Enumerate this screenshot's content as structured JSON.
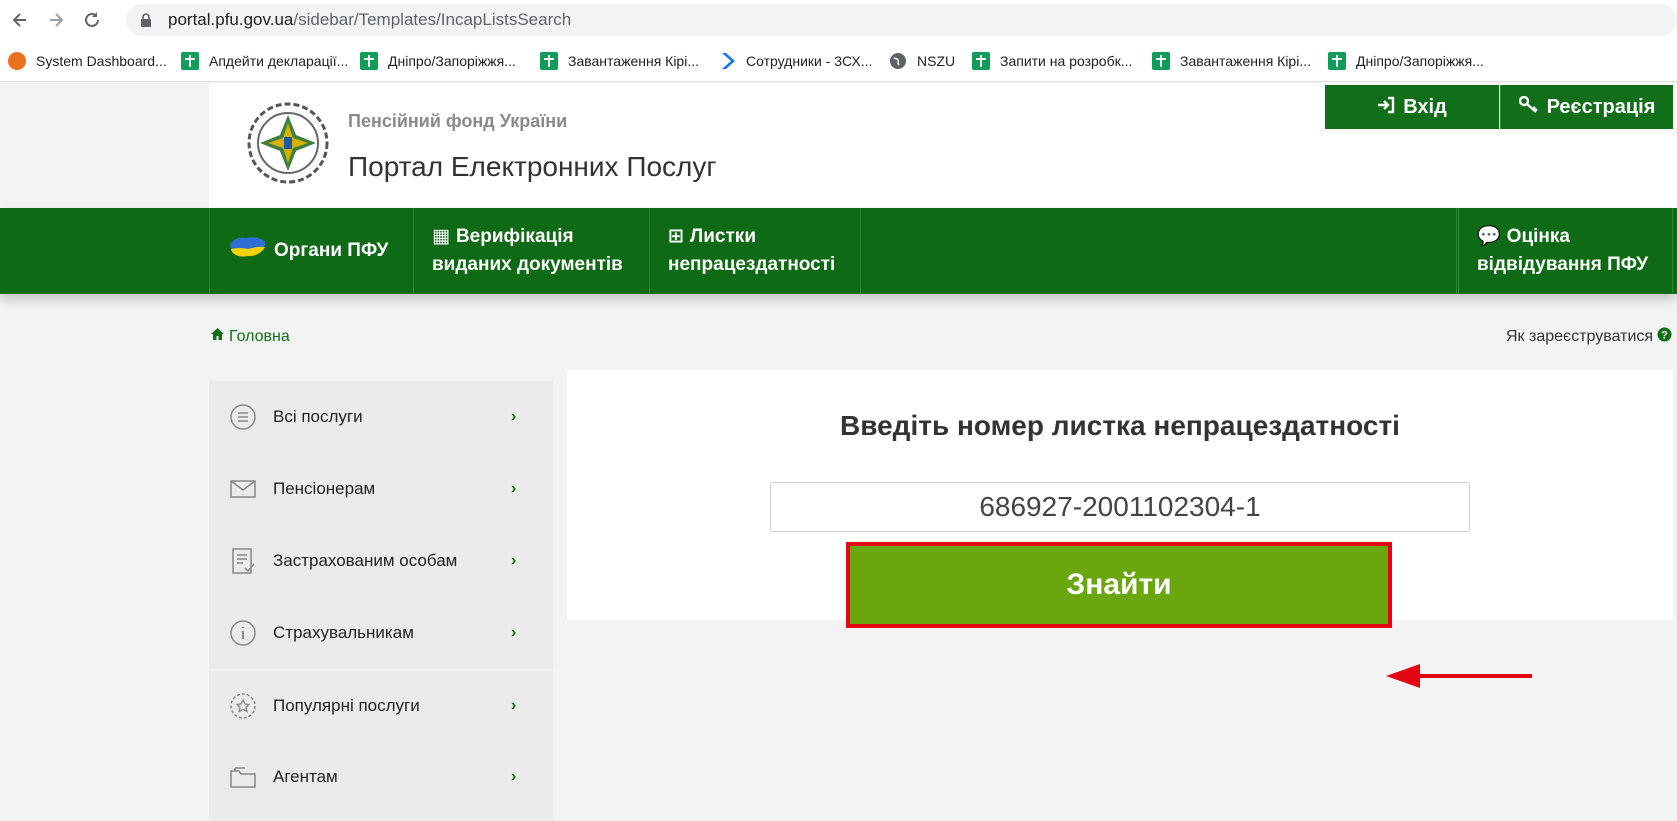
{
  "browser": {
    "url_host": "portal.pfu.gov.ua",
    "url_path": "/sidebar/Templates/IncapListsSearch",
    "bookmarks": [
      "System Dashboard...",
      "Апдейти декларації...",
      "Дніпро/Запоріжжя...",
      "Завантаження Кірі...",
      "Сотрудники - 3СХ...",
      "NSZU",
      "Запити на розробк...",
      "Завантаження Кірі...",
      "Дніпро/Запоріжжя..."
    ]
  },
  "header": {
    "org_name": "Пенсійний фонд України",
    "portal_name": "Портал Електронних Послуг",
    "login_label": "Вхід",
    "register_label": "Реєстрація"
  },
  "nav": {
    "organs": "Органи ПФУ",
    "verification_line1": "Верифікація",
    "verification_line2": "виданих документів",
    "sick_line1": "Листки",
    "sick_line2": "непрацездатності",
    "rating_line1": "Оцінка",
    "rating_line2": "відвідування ПФУ"
  },
  "breadcrumb": {
    "home": "Головна"
  },
  "help": {
    "how_register": "Як зареєструватися"
  },
  "sidebar": {
    "items": [
      {
        "label": "Всі послуги",
        "icon": "list-icon"
      },
      {
        "label": "Пенсіонерам",
        "icon": "envelope-icon"
      },
      {
        "label": "Застрахованим особам",
        "icon": "document-check-icon"
      },
      {
        "label": "Страхувальникам",
        "icon": "info-icon"
      },
      {
        "label": "Популярні послуги",
        "icon": "star-badge-icon"
      },
      {
        "label": "Агентам",
        "icon": "folder-icon"
      }
    ]
  },
  "search": {
    "title": "Введіть номер листка непрацездатності",
    "value": "686927-2001102304-1",
    "button_label": "Знайти"
  },
  "colors": {
    "brand_green": "#0f6a15",
    "button_green": "#6aa60d",
    "highlight_red": "#e30613"
  }
}
